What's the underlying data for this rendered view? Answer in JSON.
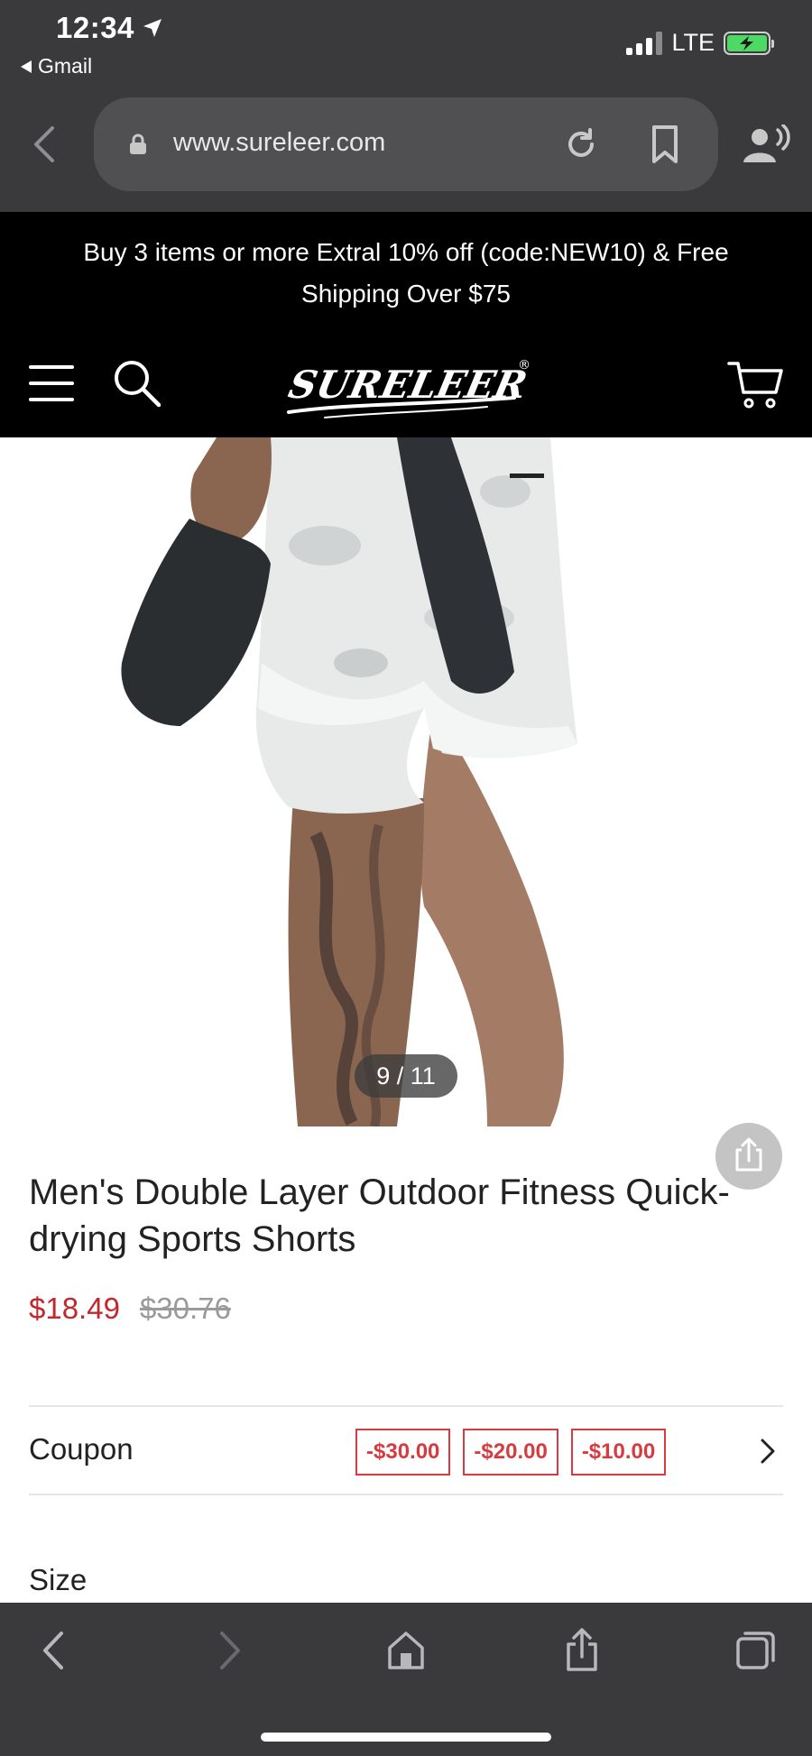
{
  "status_bar": {
    "time": "12:34",
    "back_app": "Gmail",
    "network": "LTE"
  },
  "browser": {
    "url": "www.sureleer.com"
  },
  "promo": {
    "text": "Buy 3 items or more Extral 10% off (code:NEW10) & Free Shipping Over $75"
  },
  "site": {
    "logo_text": "SURELEER",
    "logo_mark": "®"
  },
  "gallery": {
    "counter": "9 / 11"
  },
  "product": {
    "title": "Men's Double Layer Outdoor Fitness Quick-drying Sports Shorts",
    "price_sale": "$18.49",
    "price_original": "$30.76"
  },
  "coupon": {
    "label": "Coupon",
    "tags": [
      "-$30.00",
      "-$20.00",
      "-$10.00"
    ]
  },
  "size": {
    "label": "Size"
  },
  "colors": {
    "sale_red": "#c0282c",
    "coupon_red": "#d83b3f",
    "chrome_gray": "#3a3a3c",
    "banner_black": "#000000"
  }
}
